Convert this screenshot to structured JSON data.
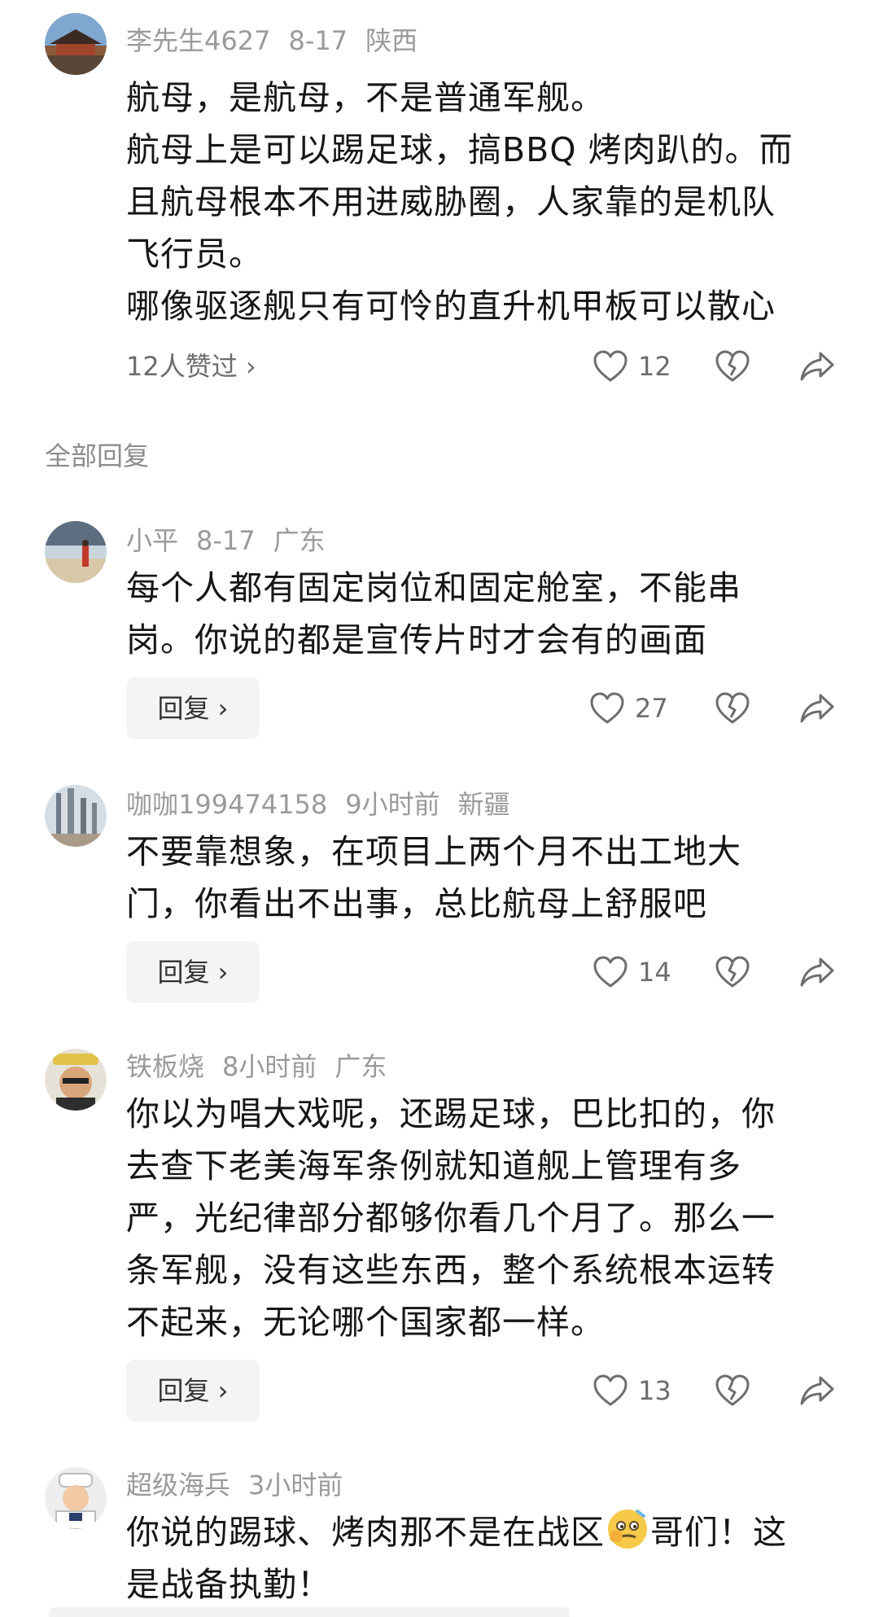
{
  "main_comment": {
    "username": "李先生4627",
    "date": "8-17",
    "location": "陕西",
    "lines": [
      "航母，是航母，不是普通军舰。",
      "航母上是可以踢足球，搞BBQ 烤肉趴的。而",
      "且航母根本不用进威胁圈，人家靠的是机队",
      "飞行员。",
      "哪像驱逐舰只有可怜的直升机甲板可以散心"
    ],
    "liked_by": "12人赞过 ›",
    "like_count": "12"
  },
  "section_title": "全部回复",
  "replies": [
    {
      "username": "小平",
      "date": "8-17",
      "location": "广东",
      "lines": [
        "每个人都有固定岗位和固定舱室，不能串",
        "岗。你说的都是宣传片时才会有的画面"
      ],
      "reply_label": "回复 ›",
      "like_count": "27"
    },
    {
      "username": "咖咖199474158",
      "date": "9小时前",
      "location": "新疆",
      "lines": [
        "不要靠想象，在项目上两个月不出工地大",
        "门，你看出不出事，总比航母上舒服吧"
      ],
      "reply_label": "回复 ›",
      "like_count": "14"
    },
    {
      "username": "铁板烧",
      "date": "8小时前",
      "location": "广东",
      "lines": [
        "你以为唱大戏呢，还踢足球，巴比扣的，你",
        "去查下老美海军条例就知道舰上管理有多",
        "严，光纪律部分都够你看几个月了。那么一",
        "条军舰，没有这些东西，整个系统根本运转",
        "不起来，无论哪个国家都一样。"
      ],
      "reply_label": "回复 ›",
      "like_count": "13"
    },
    {
      "username": "超级海兵",
      "date": "3小时前",
      "location": "",
      "line1_before_emoji": "你说的踢球、烤肉那不是在战区",
      "line1_after_emoji": "哥们！这",
      "line2": "是战备执勤！"
    }
  ],
  "icons": {
    "like": "heart-outline-icon",
    "dislike": "broken-heart-icon",
    "share": "share-arrow-icon",
    "emoji": "thinking-face-emoji"
  },
  "colors": {
    "meta_text": "#9a9a9a",
    "body_text": "#161616",
    "reply_button_bg": "#f4f4f4",
    "icon": "#6d6d6d"
  }
}
